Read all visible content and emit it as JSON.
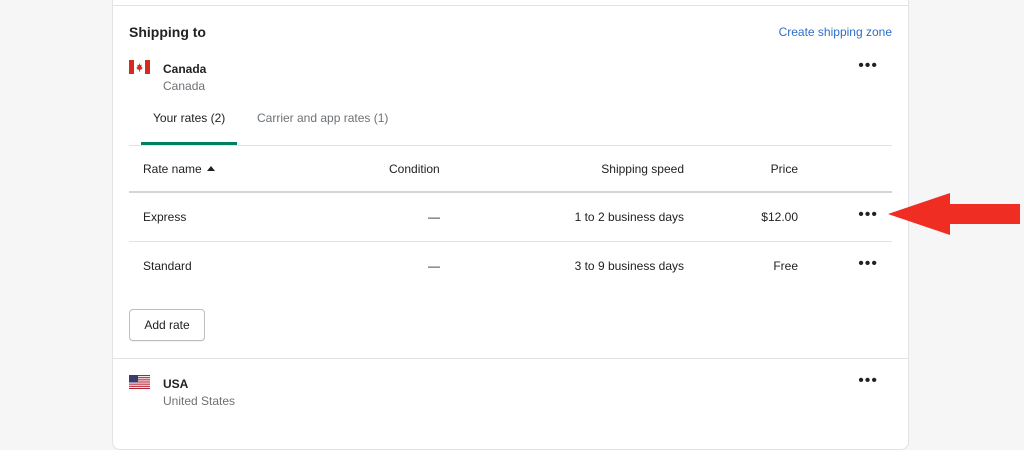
{
  "header": {
    "title": "Shipping to",
    "create_link": "Create shipping zone"
  },
  "zones": [
    {
      "name": "Canada",
      "subtitle": "Canada",
      "flag": "canada-flag-icon"
    },
    {
      "name": "USA",
      "subtitle": "United States",
      "flag": "us-flag-icon"
    }
  ],
  "tabs": [
    {
      "label": "Your rates (2)",
      "active": true
    },
    {
      "label": "Carrier and app rates (1)",
      "active": false
    }
  ],
  "table": {
    "headers": [
      "Rate name",
      "Condition",
      "Shipping speed",
      "Price"
    ],
    "rows": [
      {
        "name": "Express",
        "condition": "—",
        "speed": "1 to 2 business days",
        "price": "$12.00"
      },
      {
        "name": "Standard",
        "condition": "—",
        "speed": "3 to 9 business days",
        "price": "Free"
      }
    ]
  },
  "more_label": "•••",
  "add_rate_label": "Add rate",
  "colors": {
    "accent_tab": "#008060",
    "link": "#2c6ecb",
    "annotation_arrow": "#f02d22"
  }
}
